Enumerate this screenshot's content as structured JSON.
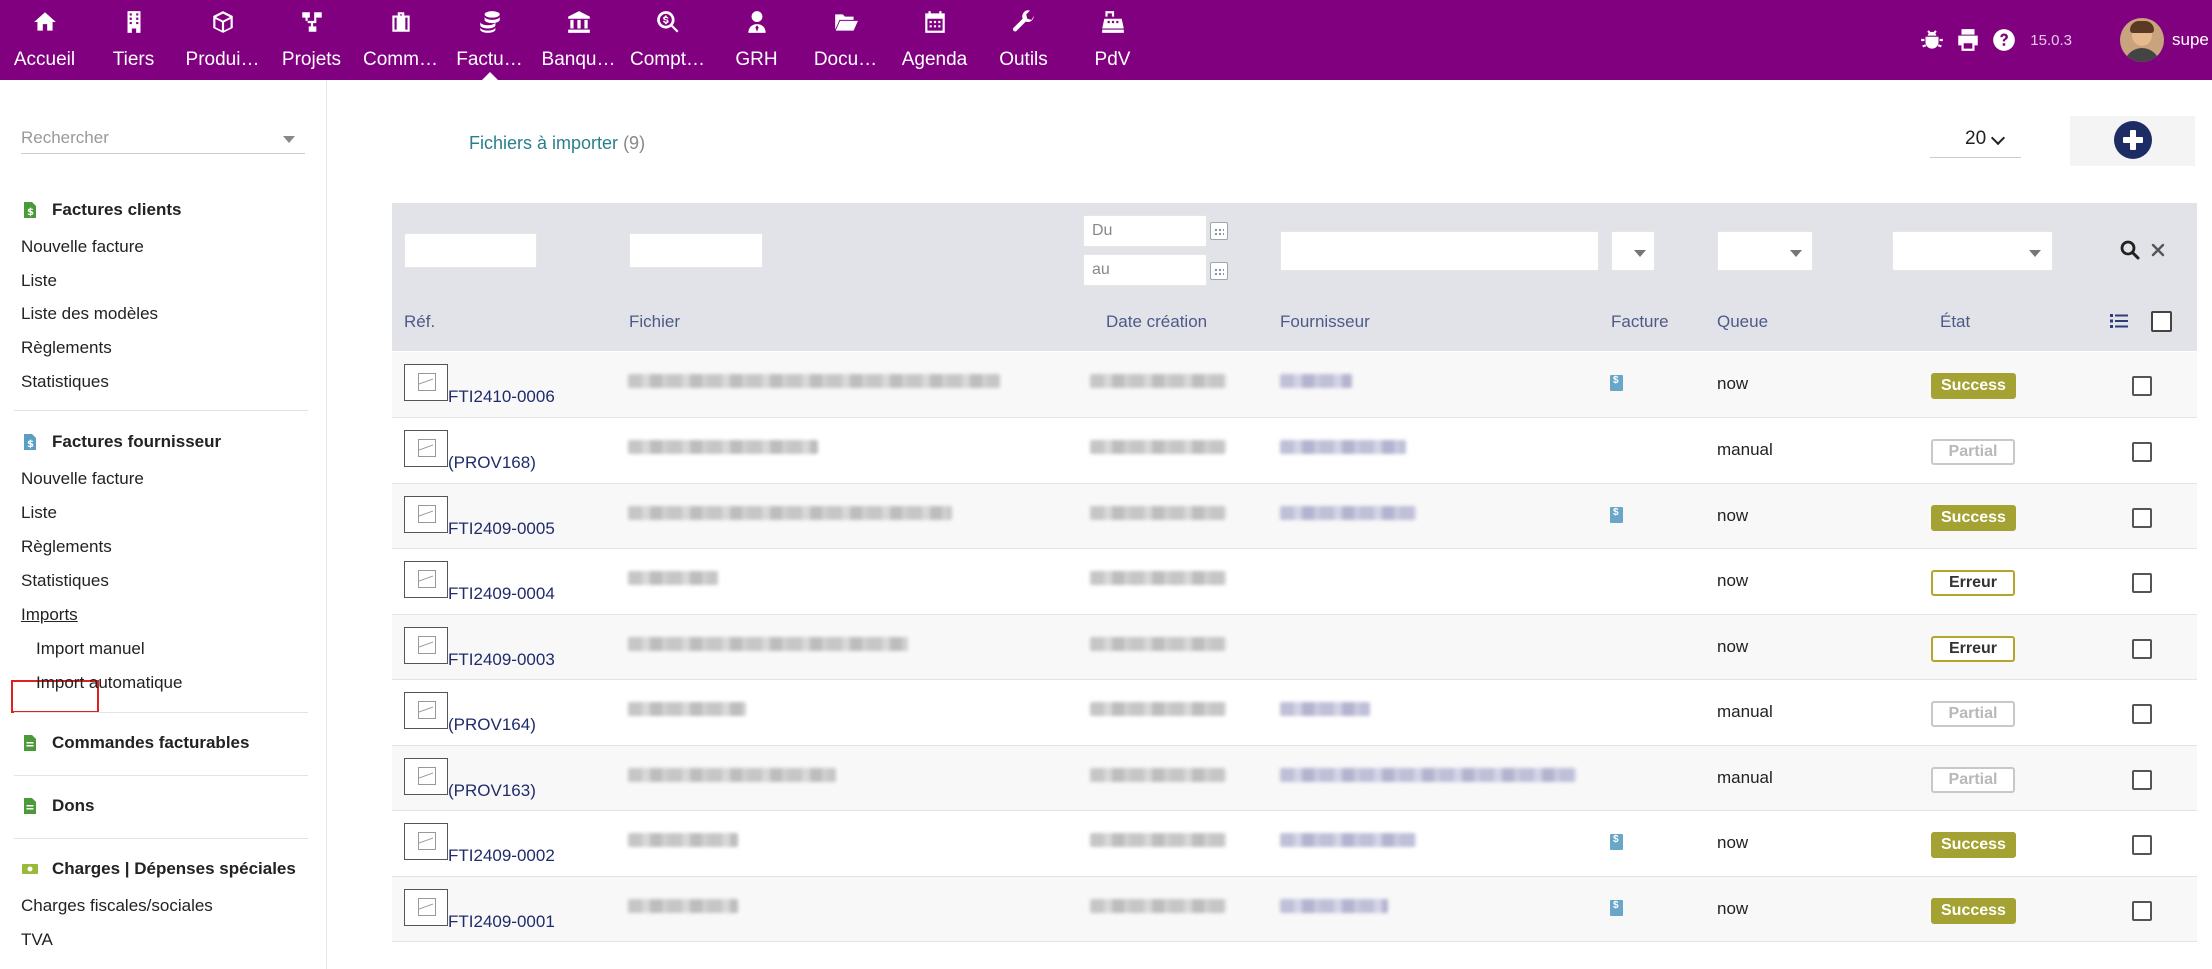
{
  "topnav": {
    "items": [
      {
        "label": "Accueil",
        "icon": "home-icon"
      },
      {
        "label": "Tiers",
        "icon": "building-icon"
      },
      {
        "label": "Produi…",
        "icon": "cube-icon"
      },
      {
        "label": "Projets",
        "icon": "sitemap-icon"
      },
      {
        "label": "Comm…",
        "icon": "briefcase-icon"
      },
      {
        "label": "Factu…",
        "icon": "coins-icon"
      },
      {
        "label": "Banqu…",
        "icon": "bank-icon"
      },
      {
        "label": "Compt…",
        "icon": "search-dollar-icon"
      },
      {
        "label": "GRH",
        "icon": "user-tie-icon"
      },
      {
        "label": "Docu…",
        "icon": "folder-open-icon"
      },
      {
        "label": "Agenda",
        "icon": "calendar-icon"
      },
      {
        "label": "Outils",
        "icon": "wrench-icon"
      },
      {
        "label": "PdV",
        "icon": "cash-register-icon"
      }
    ],
    "active_index": 5,
    "version": "15.0.3",
    "username": "supe"
  },
  "sidebar": {
    "search_placeholder": "Rechercher",
    "factures_clients": {
      "title": "Factures clients",
      "links": [
        "Nouvelle facture",
        "Liste",
        "Liste des modèles",
        "Règlements",
        "Statistiques"
      ]
    },
    "factures_fournisseur": {
      "title": "Factures fournisseur",
      "links": [
        "Nouvelle facture",
        "Liste",
        "Règlements",
        "Statistiques"
      ],
      "imports": "Imports",
      "import_manuel": "Import manuel",
      "import_auto": "Import automatique"
    },
    "commandes_title": "Commandes facturables",
    "dons_title": "Dons",
    "charges": {
      "title": "Charges | Dépenses spéciales",
      "links": [
        "Charges fiscales/sociales",
        "TVA"
      ]
    }
  },
  "main": {
    "title": "Fichiers à importer",
    "count": "(9)",
    "limit": "20",
    "filters": {
      "date_from_placeholder": "Du",
      "date_to_placeholder": "au"
    },
    "columns": {
      "ref": "Réf.",
      "fichier": "Fichier",
      "date": "Date création",
      "fournisseur": "Fournisseur",
      "facture": "Facture",
      "queue": "Queue",
      "etat": "État"
    },
    "rows": [
      {
        "ref": "FTI2410-0006",
        "queue": "now",
        "etat": "Success",
        "has_facture": true
      },
      {
        "ref": "(PROV168)",
        "queue": "manual",
        "etat": "Partial",
        "has_facture": false
      },
      {
        "ref": "FTI2409-0005",
        "queue": "now",
        "etat": "Success",
        "has_facture": true
      },
      {
        "ref": "FTI2409-0004",
        "queue": "now",
        "etat": "Erreur",
        "has_facture": false
      },
      {
        "ref": "FTI2409-0003",
        "queue": "now",
        "etat": "Erreur",
        "has_facture": false
      },
      {
        "ref": "(PROV164)",
        "queue": "manual",
        "etat": "Partial",
        "has_facture": false
      },
      {
        "ref": "(PROV163)",
        "queue": "manual",
        "etat": "Partial",
        "has_facture": false
      },
      {
        "ref": "FTI2409-0002",
        "queue": "now",
        "etat": "Success",
        "has_facture": true
      },
      {
        "ref": "FTI2409-0001",
        "queue": "now",
        "etat": "Success",
        "has_facture": true
      }
    ]
  },
  "colors": {
    "topbar": "#800080",
    "success": "#a3a232",
    "link": "#1f2b6b",
    "title": "#2a7f8a"
  }
}
